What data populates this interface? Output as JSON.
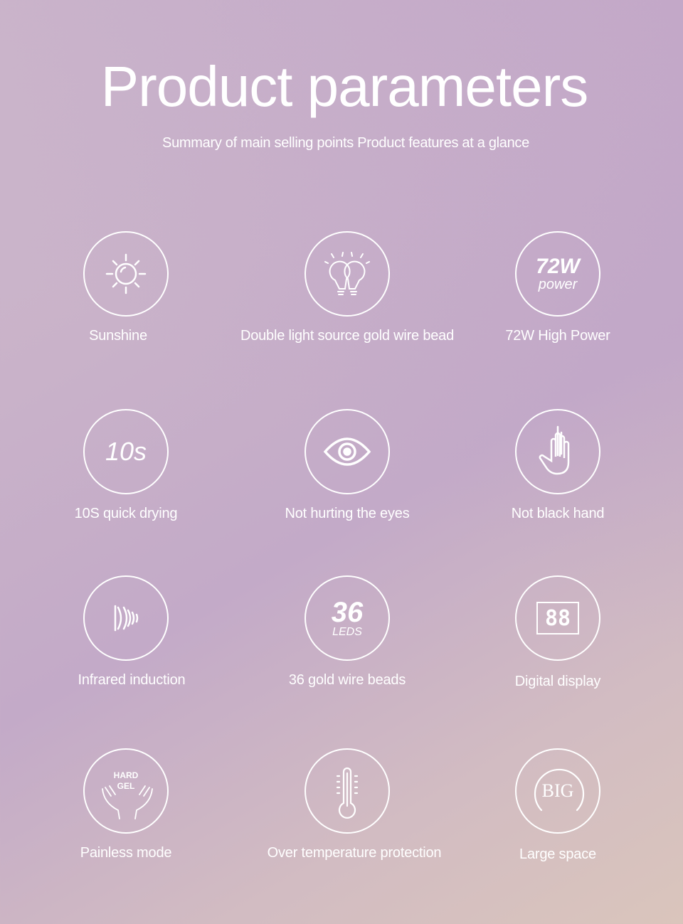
{
  "header": {
    "title": "Product parameters",
    "subtitle": "Summary of main selling points Product features at a glance"
  },
  "colors": {
    "background_top": "#c3aac8",
    "background_bottom": "#dac5bc",
    "foreground": "#ffffff"
  },
  "features": [
    {
      "label": "Sunshine",
      "icon": "sun-icon"
    },
    {
      "label": "Double light source gold wire bead",
      "icon": "double-bulb-icon"
    },
    {
      "label": "72W High Power",
      "icon": "power-72w-icon",
      "icon_text": "72W",
      "icon_subtext": "power"
    },
    {
      "label": "10S quick drying",
      "icon": "timer-10s-icon",
      "icon_text": "10s"
    },
    {
      "label": "Not hurting the eyes",
      "icon": "eye-icon"
    },
    {
      "label": "Not black hand",
      "icon": "hand-icon"
    },
    {
      "label": "Infrared induction",
      "icon": "infrared-icon"
    },
    {
      "label": "36 gold wire beads",
      "icon": "leds-36-icon",
      "icon_text": "36",
      "icon_subtext": "LEDS"
    },
    {
      "label": "Digital display",
      "icon": "digital-display-icon",
      "icon_text": "88"
    },
    {
      "label": "Painless mode",
      "icon": "hands-hard-gel-icon",
      "icon_text": "HARD",
      "icon_subtext": "GEL"
    },
    {
      "label": "Over temperature protection",
      "icon": "thermometer-icon"
    },
    {
      "label": "Large space",
      "icon": "big-space-icon",
      "icon_text": "BIG"
    }
  ]
}
